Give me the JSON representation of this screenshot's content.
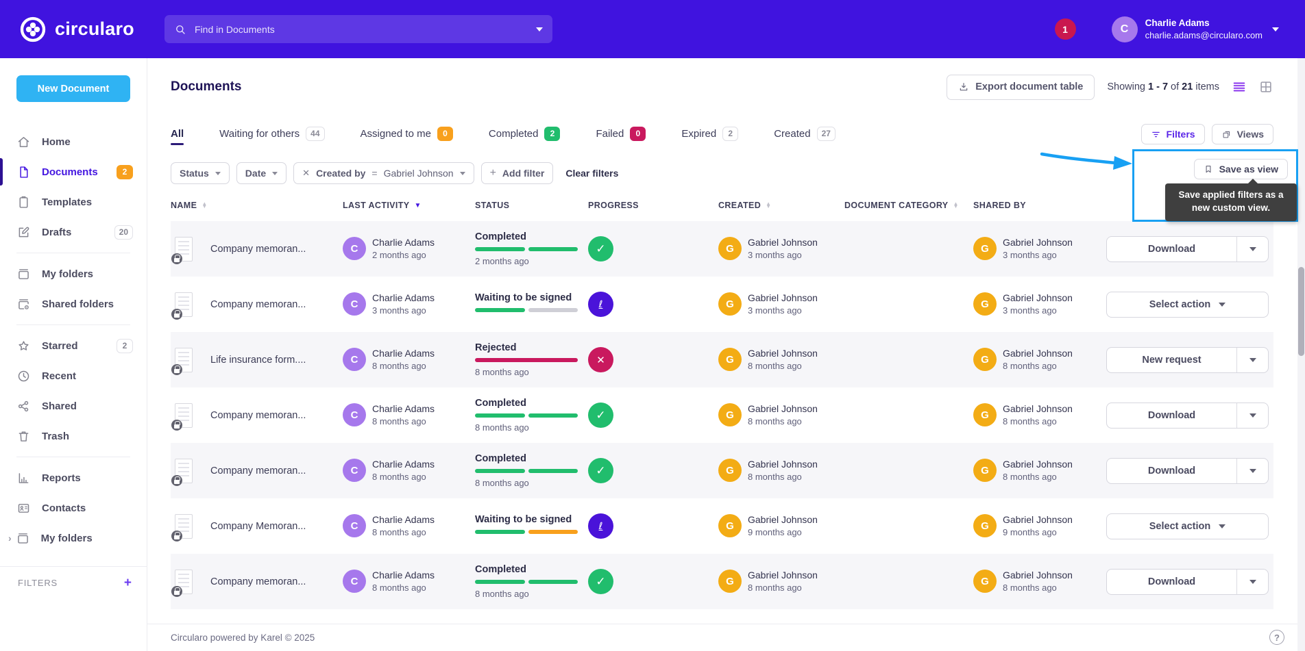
{
  "colors": {
    "brand_purple": "#4013df",
    "sidebar_active": "#4517e0",
    "indicator": "#2d1193",
    "button_blue": "#2fb3f3",
    "orange": "#f8a01d",
    "green": "#21bd6d",
    "crimson": "#c9195e",
    "indigo": "#4a13d9",
    "avatar_purple": "#a678ec",
    "avatar_gold": "#f3ac15",
    "callout_blue": "#18a0f3",
    "tooltip_bg": "#3f3f3f",
    "title_navy": "#1e1356",
    "badge_red": "#c9174f"
  },
  "topbar": {
    "logo": "circularo",
    "search_placeholder": "Find in Documents",
    "notification_count": "1",
    "user_name": "Charlie Adams",
    "user_email": "charlie.adams@circularo.com",
    "user_initial": "C"
  },
  "sidebar": {
    "new_document": "New Document",
    "filters_label": "FILTERS",
    "items": [
      {
        "label": "Home",
        "icon": "home"
      },
      {
        "label": "Documents",
        "icon": "document",
        "badge": "2",
        "badge_style": "orange",
        "state": "active"
      },
      {
        "label": "Templates",
        "icon": "template"
      },
      {
        "label": "Drafts",
        "icon": "draft",
        "badge": "20",
        "badge_style": "plain"
      },
      {
        "label": "My folders",
        "icon": "folder",
        "divider_before": true
      },
      {
        "label": "Shared folders",
        "icon": "shared-folder"
      },
      {
        "label": "Starred",
        "icon": "star",
        "badge": "2",
        "badge_style": "plain",
        "divider_before": true
      },
      {
        "label": "Recent",
        "icon": "clock"
      },
      {
        "label": "Shared",
        "icon": "share"
      },
      {
        "label": "Trash",
        "icon": "trash"
      },
      {
        "label": "Reports",
        "icon": "report",
        "divider_before": true
      },
      {
        "label": "Contacts",
        "icon": "contacts"
      },
      {
        "label": "My folders",
        "icon": "folders",
        "chevron": true
      }
    ]
  },
  "header": {
    "title": "Documents",
    "export_label": "Export document table",
    "showing_prefix": "Showing",
    "showing_range": "1 - 7",
    "showing_of": "of",
    "showing_total": "21",
    "showing_suffix": "items"
  },
  "tabs": [
    {
      "label": "All",
      "state": "active"
    },
    {
      "label": "Waiting for others",
      "badge": "44",
      "badge_style": "outline"
    },
    {
      "label": "Assigned to me",
      "badge": "0",
      "badge_style": "orange"
    },
    {
      "label": "Completed",
      "badge": "2",
      "badge_style": "green"
    },
    {
      "label": "Failed",
      "badge": "0",
      "badge_style": "crimson"
    },
    {
      "label": "Expired",
      "badge": "2",
      "badge_style": "outline"
    },
    {
      "label": "Created",
      "badge": "27",
      "badge_style": "outline"
    }
  ],
  "filter_bar": {
    "status_label": "Status",
    "date_label": "Date",
    "created_by_label": "Created by",
    "created_by_operator": "=",
    "created_by_value": "Gabriel Johnson",
    "add_filter_label": "Add filter",
    "clear_label": "Clear filters",
    "filters_button": "Filters",
    "views_button": "Views"
  },
  "save_view": {
    "button_label": "Save as view",
    "tooltip": "Save applied filters as a new custom view."
  },
  "table": {
    "columns": [
      {
        "label": "NAME",
        "sort_both": true
      },
      {
        "label": "LAST ACTIVITY",
        "sort_desc": true
      },
      {
        "label": "STATUS"
      },
      {
        "label": "PROGRESS"
      },
      {
        "label": "CREATED",
        "sort_both": true
      },
      {
        "label": "DOCUMENT CATEGORY",
        "sort_both": true
      },
      {
        "label": "SHARED BY"
      }
    ],
    "rows": [
      {
        "name": "Company memoran...",
        "activity_initial": "C",
        "activity_name": "Charlie Adams",
        "activity_time": "2 months ago",
        "status": "Completed",
        "status_time": "2 months ago",
        "bar": "bar-complete",
        "badge": "badge-check",
        "created_initial": "G",
        "created_name": "Gabriel Johnson",
        "created_time": "3 months ago",
        "shared_initial": "G",
        "shared_name": "Gabriel Johnson",
        "shared_time": "3 months ago",
        "action_label": "Download",
        "action_type": "action-split"
      },
      {
        "name": "Company memoran...",
        "activity_initial": "C",
        "activity_name": "Charlie Adams",
        "activity_time": "3 months ago",
        "status": "Waiting to be signed",
        "status_time": "",
        "bar": "bar-waiting",
        "badge": "badge-sign",
        "created_initial": "G",
        "created_name": "Gabriel Johnson",
        "created_time": "3 months ago",
        "shared_initial": "G",
        "shared_name": "Gabriel Johnson",
        "shared_time": "3 months ago",
        "action_label": "Select action",
        "action_type": "action-single"
      },
      {
        "name": "Life insurance form....",
        "activity_initial": "C",
        "activity_name": "Charlie Adams",
        "activity_time": "8 months ago",
        "status": "Rejected",
        "status_time": "8 months ago",
        "bar": "bar-rejected",
        "badge": "badge-cross",
        "created_initial": "G",
        "created_name": "Gabriel Johnson",
        "created_time": "8 months ago",
        "shared_initial": "G",
        "shared_name": "Gabriel Johnson",
        "shared_time": "8 months ago",
        "action_label": "New request",
        "action_type": "action-split"
      },
      {
        "name": "Company memoran...",
        "activity_initial": "C",
        "activity_name": "Charlie Adams",
        "activity_time": "8 months ago",
        "status": "Completed",
        "status_time": "8 months ago",
        "bar": "bar-complete",
        "badge": "badge-check",
        "created_initial": "G",
        "created_name": "Gabriel Johnson",
        "created_time": "8 months ago",
        "shared_initial": "G",
        "shared_name": "Gabriel Johnson",
        "shared_time": "8 months ago",
        "action_label": "Download",
        "action_type": "action-split"
      },
      {
        "name": "Company memoran...",
        "activity_initial": "C",
        "activity_name": "Charlie Adams",
        "activity_time": "8 months ago",
        "status": "Completed",
        "status_time": "8 months ago",
        "bar": "bar-complete",
        "badge": "badge-check",
        "created_initial": "G",
        "created_name": "Gabriel Johnson",
        "created_time": "8 months ago",
        "shared_initial": "G",
        "shared_name": "Gabriel Johnson",
        "shared_time": "8 months ago",
        "action_label": "Download",
        "action_type": "action-split"
      },
      {
        "name": "Company Memoran...",
        "activity_initial": "C",
        "activity_name": "Charlie Adams",
        "activity_time": "8 months ago",
        "status": "Waiting to be signed",
        "status_time": "",
        "bar": "bar-waiting-orange",
        "badge": "badge-sign",
        "created_initial": "G",
        "created_name": "Gabriel Johnson",
        "created_time": "9 months ago",
        "shared_initial": "G",
        "shared_name": "Gabriel Johnson",
        "shared_time": "9 months ago",
        "action_label": "Select action",
        "action_type": "action-single"
      },
      {
        "name": "Company memoran...",
        "activity_initial": "C",
        "activity_name": "Charlie Adams",
        "activity_time": "8 months ago",
        "status": "Completed",
        "status_time": "8 months ago",
        "bar": "bar-complete",
        "badge": "badge-check",
        "created_initial": "G",
        "created_name": "Gabriel Johnson",
        "created_time": "8 months ago",
        "shared_initial": "G",
        "shared_name": "Gabriel Johnson",
        "shared_time": "8 months ago",
        "action_label": "Download",
        "action_type": "action-split"
      }
    ]
  },
  "footer": {
    "text": "Circularo powered by Karel © 2025",
    "help": "?"
  }
}
